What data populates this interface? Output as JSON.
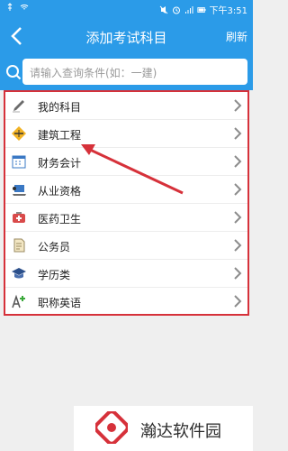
{
  "status_bar": {
    "time": "下午3:51",
    "icons": [
      "usb-icon",
      "wifi-icon",
      "mute-icon",
      "alarm-icon",
      "signal-icon",
      "battery-icon"
    ]
  },
  "header": {
    "title": "添加考试科目",
    "right_action": "刷新",
    "back_icon": "back-arrow-icon"
  },
  "search": {
    "placeholder": "请输入查询条件(如：一建)",
    "icon": "search-icon"
  },
  "categories": [
    {
      "label": "我的科目",
      "icon": "pen-icon"
    },
    {
      "label": "建筑工程",
      "icon": "construction-sign-icon"
    },
    {
      "label": "财务会计",
      "icon": "calendar-icon"
    },
    {
      "label": "从业资格",
      "icon": "laptop-person-icon"
    },
    {
      "label": "医药卫生",
      "icon": "medical-kit-icon"
    },
    {
      "label": "公务员",
      "icon": "document-icon"
    },
    {
      "label": "学历类",
      "icon": "graduation-cap-icon"
    },
    {
      "label": "职称英语",
      "icon": "translate-icon"
    }
  ],
  "watermark": {
    "text": "瀚达软件园"
  },
  "colors": {
    "primary": "#2b9be8",
    "highlight": "#d6313a"
  }
}
